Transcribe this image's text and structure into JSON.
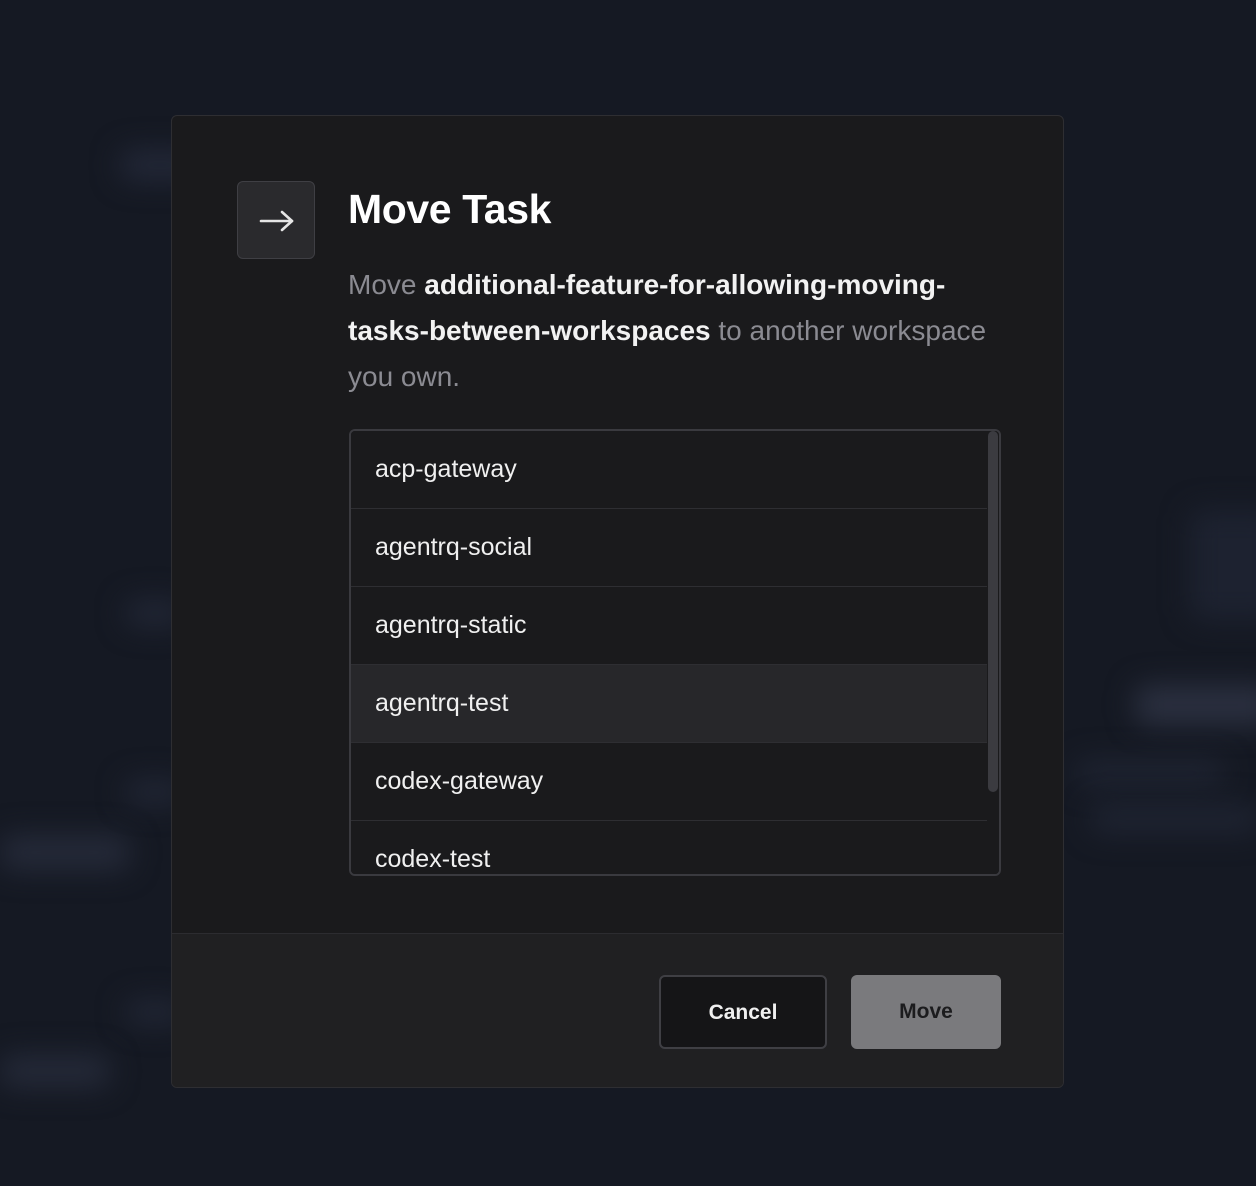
{
  "dialog": {
    "icon": "arrow-right-icon",
    "title": "Move Task",
    "description_prefix": "Move ",
    "task_name": "additional-feature-for-allowing-moving-tasks-between-workspaces",
    "description_suffix": " to another workspace you own."
  },
  "workspaces": {
    "items": [
      {
        "label": "acp-gateway"
      },
      {
        "label": "agentrq-social"
      },
      {
        "label": "agentrq-static"
      },
      {
        "label": "agentrq-test"
      },
      {
        "label": "codex-gateway"
      },
      {
        "label": "codex-test"
      }
    ],
    "selected": "agentrq-test"
  },
  "footer": {
    "cancel_label": "Cancel",
    "move_label": "Move"
  },
  "colors": {
    "backdrop": "#151923",
    "modal": "#1a1a1c",
    "selected_row": "#27272a",
    "move_button_disabled": "#7a7a7d"
  }
}
